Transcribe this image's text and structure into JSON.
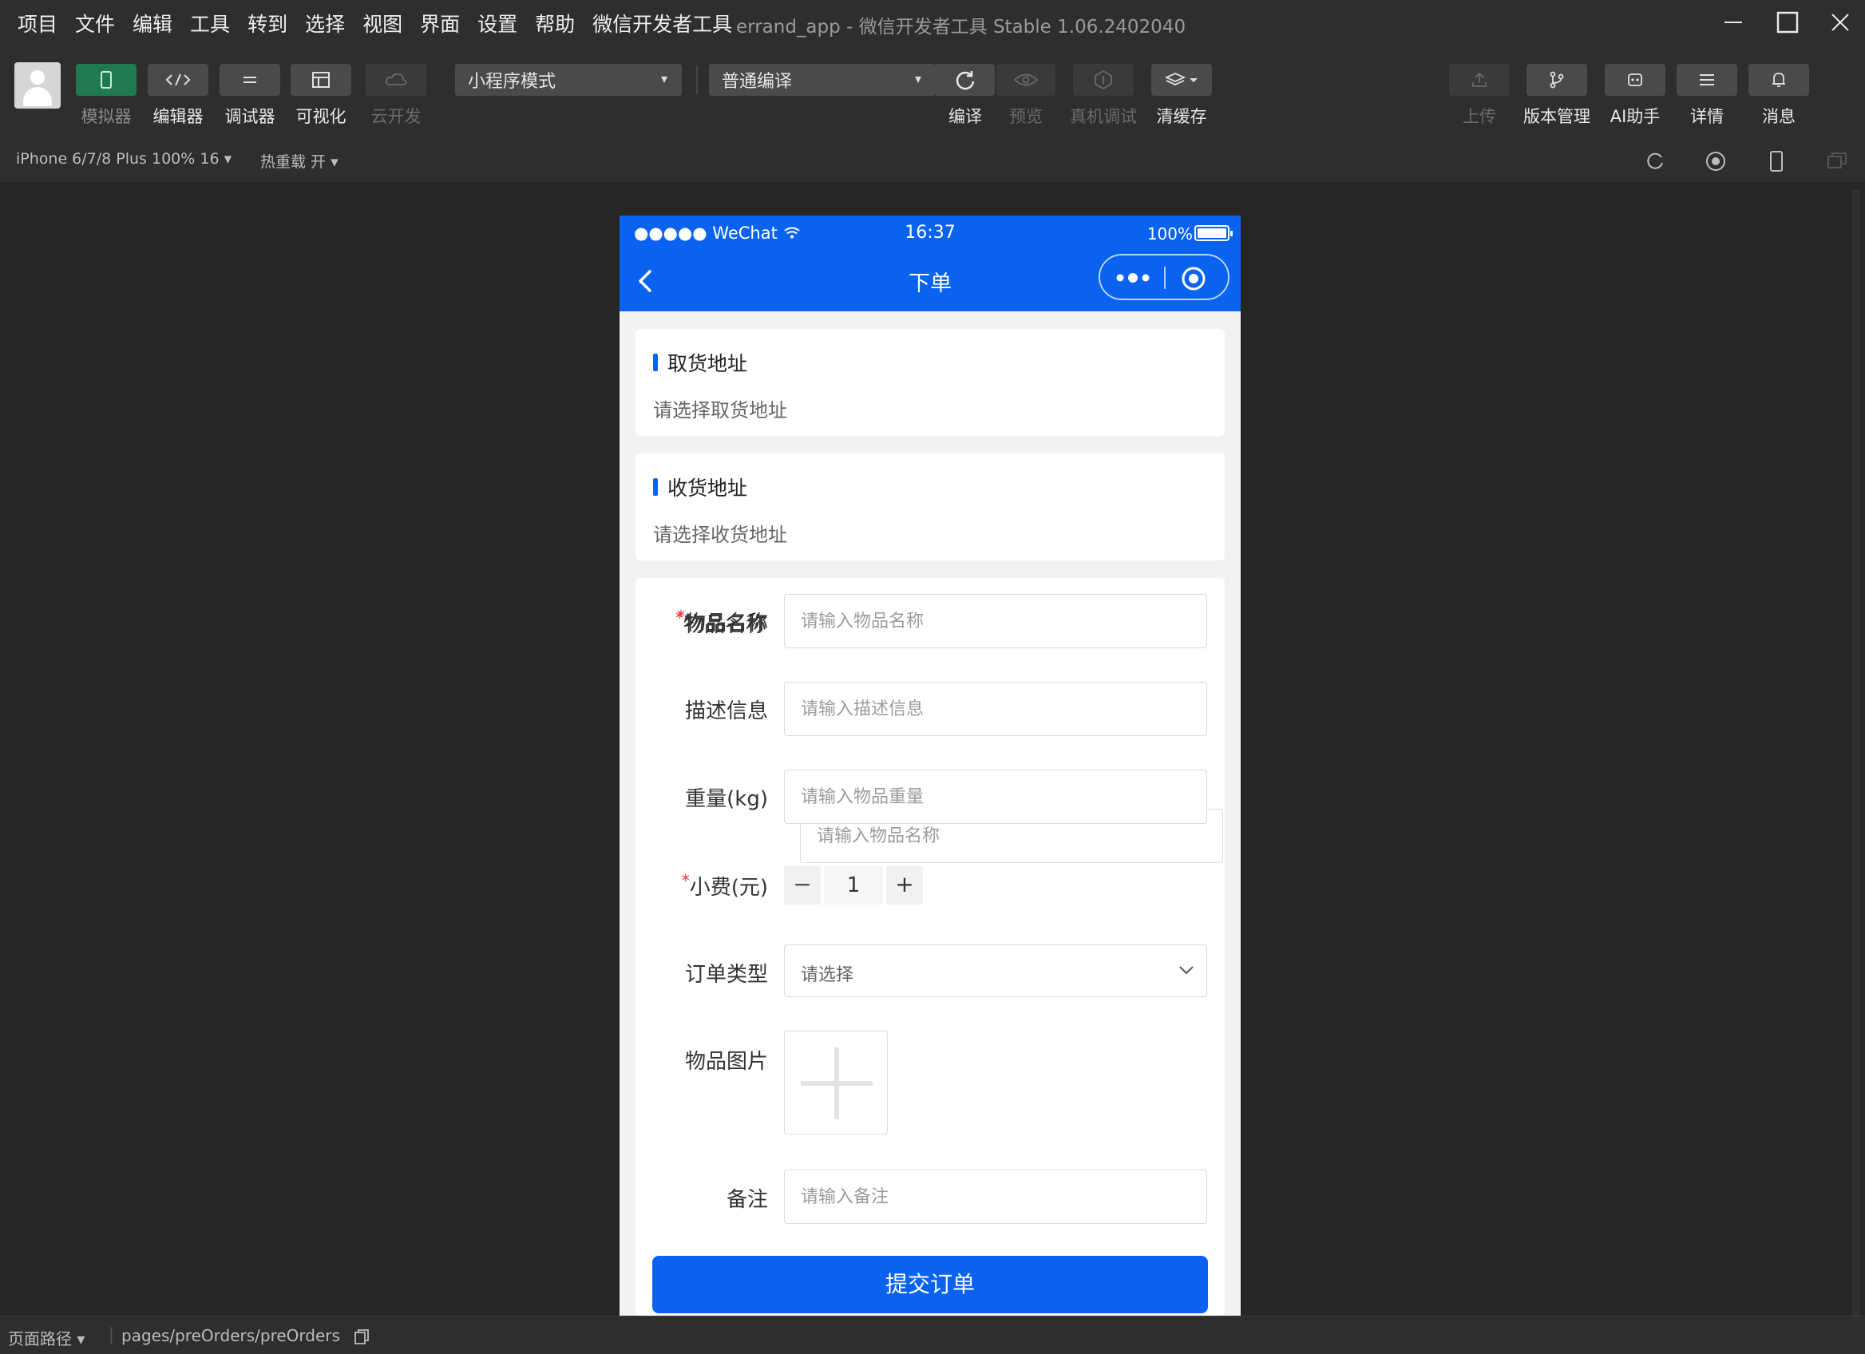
{
  "menu": [
    "项目",
    "文件",
    "编辑",
    "工具",
    "转到",
    "选择",
    "视图",
    "界面",
    "设置",
    "帮助",
    "微信开发者工具"
  ],
  "window_title": "errand_app - 微信开发者工具 Stable 1.06.2402040",
  "toolbar": {
    "simulator": "模拟器",
    "editor": "编辑器",
    "debugger": "调试器",
    "visual": "可视化",
    "cloud": "云开发",
    "mode_select": "小程序模式",
    "compile_select": "普通编译",
    "compile": "编译",
    "preview": "预览",
    "real_debug": "真机调试",
    "clear_cache": "清缓存",
    "upload": "上传",
    "version": "版本管理",
    "ai": "AI助手",
    "details": "详情",
    "messages": "消息"
  },
  "subbar": {
    "device": "iPhone 6/7/8 Plus 100% 16 ▾",
    "hot_reload": "热重载 开 ▾"
  },
  "phone": {
    "carrier": "●●●●● WeChat",
    "time": "16:37",
    "battery": "100%",
    "nav_title": "下单"
  },
  "pickup": {
    "title": "取货地址",
    "placeholder": "请选择取货地址"
  },
  "delivery": {
    "title": "收货地址",
    "placeholder": "请选择收货地址"
  },
  "form": {
    "item_name_label": "物品名称",
    "item_name_placeholder": "请输入物品名称",
    "desc_label": "描述信息",
    "desc_placeholder": "请输入描述信息",
    "weight_label": "重量(kg)",
    "weight_placeholder": "请输入物品重量",
    "tip_label": "小费(元)",
    "tip_value": "1",
    "type_label": "订单类型",
    "type_placeholder": "请选择",
    "image_label": "物品图片",
    "remark_label": "备注",
    "remark_placeholder": "请输入备注",
    "submit": "提交订单"
  },
  "bottom": {
    "page_path_label": "页面路径 ▾",
    "page_path": "pages/preOrders/preOrders"
  },
  "colors": {
    "brand_blue": "#0a63f0",
    "required_red": "#e33333",
    "ide_bg": "#262626"
  }
}
